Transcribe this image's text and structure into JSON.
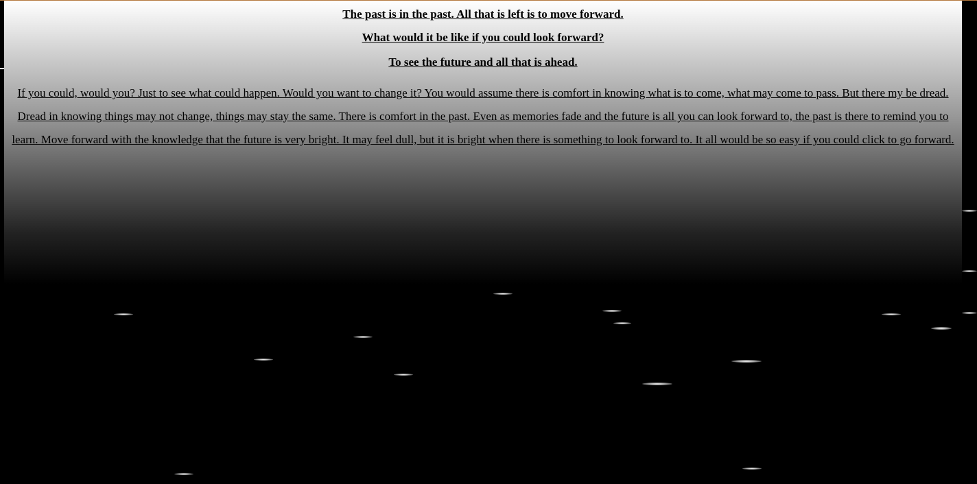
{
  "page": {
    "background_color": "#000000",
    "accent_border_color": "#b5793f"
  },
  "headings": [
    "The past is in the past. All that is left is to move forward.",
    "What would it be like if you could look forward?",
    "To see the future and all that is ahead."
  ],
  "forward_link": {
    "text": "If you could, would you? Just to see what could happen. Would you want to change it? You would assume there is comfort in knowing what is to come, what may come to pass. But there my be dread. Dread in knowing things may not change, things may stay the same. There is comfort in the past. Even as memories fade and the future is all you can look forward to, the past is there to remind you to learn. Move forward with the knowledge that the future is very bright. It may feel dull, but it is bright when there is something to look forward to. It all would be so easy if you could click to go forward."
  }
}
